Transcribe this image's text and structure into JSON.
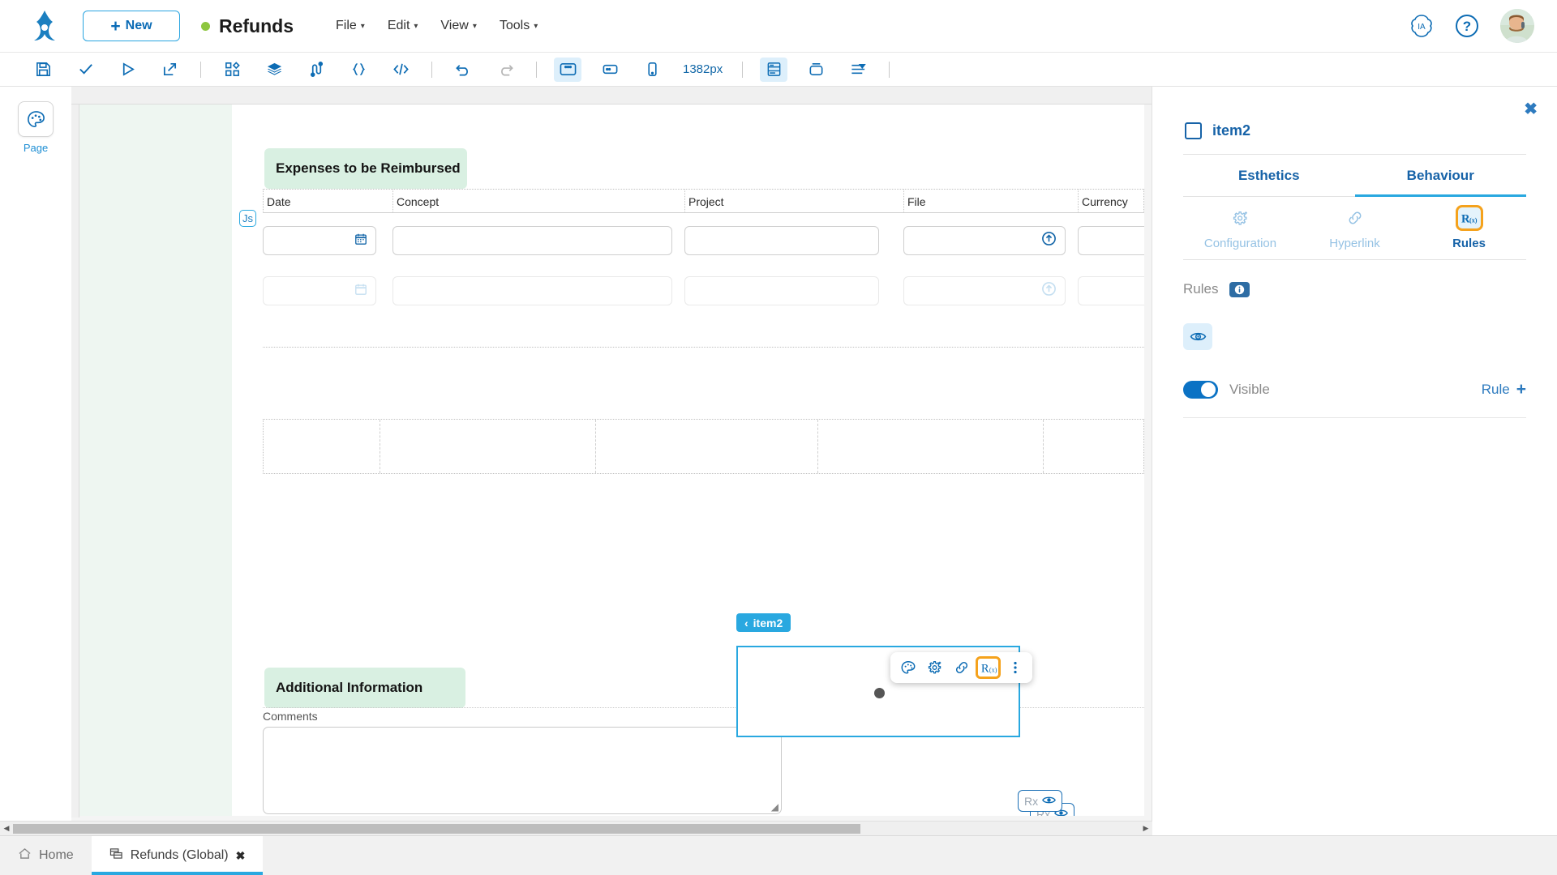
{
  "topbar": {
    "logo_icon": "frog-logo-icon",
    "new_button": {
      "label": "New",
      "plus": "+"
    },
    "status_dot_color": "#8dc63f",
    "document_title": "Refunds",
    "menus": [
      {
        "label": "File",
        "caret": "▾"
      },
      {
        "label": "Edit",
        "caret": "▾"
      },
      {
        "label": "View",
        "caret": "▾"
      },
      {
        "label": "Tools",
        "caret": "▾"
      }
    ],
    "right_icons": [
      {
        "name": "ia-assistant-icon",
        "label": "IA"
      },
      {
        "name": "help-icon",
        "label": "?"
      }
    ],
    "avatar_name": "user-avatar"
  },
  "toolbar": {
    "zoom_width_label": "1382px",
    "buttons": [
      {
        "name": "save-icon"
      },
      {
        "name": "validate-check-icon"
      },
      {
        "name": "run-play-icon"
      },
      {
        "name": "publish-export-icon"
      },
      {
        "name": "components-grid-icon"
      },
      {
        "name": "layers-icon"
      },
      {
        "name": "flow-connectors-icon"
      },
      {
        "name": "braces-data-icon"
      },
      {
        "name": "code-icon"
      },
      {
        "name": "undo-icon"
      },
      {
        "name": "redo-icon"
      },
      {
        "name": "desktop-preview-icon"
      },
      {
        "name": "tablet-preview-icon"
      },
      {
        "name": "mobile-preview-icon"
      },
      {
        "name": "form-layout-icon"
      },
      {
        "name": "container-icon"
      },
      {
        "name": "align-distribute-icon"
      }
    ]
  },
  "left_rail": {
    "items": [
      {
        "name": "page-palette",
        "label": "Page",
        "icon": "palette-icon"
      }
    ]
  },
  "canvas": {
    "sections": [
      {
        "title": "Expenses to be Reimbursed"
      },
      {
        "title": "Additional Information"
      }
    ],
    "expenses_table": {
      "columns": [
        "Date",
        "Concept",
        "Project",
        "File",
        "Currency"
      ],
      "rows": [
        {
          "date": "",
          "concept": "",
          "project": "",
          "file": "",
          "currency": ""
        },
        {
          "date": "",
          "concept": "",
          "project": "",
          "file": "",
          "currency": ""
        }
      ]
    },
    "comments": {
      "label": "Comments",
      "value": ""
    },
    "selected_element": {
      "tag_label": "item2",
      "tag_chevron": "‹"
    },
    "js_badge_label": "Js",
    "rx_badges": [
      {
        "label": "Rx"
      },
      {
        "label": "Rx"
      }
    ],
    "float_toolbar": [
      {
        "name": "esthetics-palette-icon",
        "selected": false
      },
      {
        "name": "configuration-gear-icon",
        "selected": false
      },
      {
        "name": "hyperlink-icon",
        "selected": false
      },
      {
        "name": "rules-rx-icon",
        "selected": true
      },
      {
        "name": "more-options-icon",
        "selected": false
      }
    ]
  },
  "right_panel": {
    "close_label": "✖",
    "element_name": "item2",
    "tabs": [
      {
        "label": "Esthetics",
        "active": false
      },
      {
        "label": "Behaviour",
        "active": true
      }
    ],
    "subtabs": [
      {
        "label": "Configuration",
        "icon": "configuration-gear-icon",
        "active": false
      },
      {
        "label": "Hyperlink",
        "icon": "hyperlink-icon",
        "active": false
      },
      {
        "label": "Rules",
        "icon": "rules-rx-icon",
        "active": true
      }
    ],
    "rules_label": "Rules",
    "rules_info_icon": "info-icon",
    "visibility_icon": "eye-icon",
    "visible_toggle": {
      "label": "Visible",
      "on": true
    },
    "add_rule": {
      "label": "Rule",
      "plus": "+"
    }
  },
  "bottom": {
    "scroll_left_arrow": "◀",
    "scroll_right_arrow": "▶",
    "tabs": [
      {
        "label": "Home",
        "icon": "home-icon",
        "active": false,
        "closable": false
      },
      {
        "label": "Refunds (Global)",
        "icon": "form-icon",
        "active": true,
        "closable": true,
        "close": "✖"
      }
    ]
  },
  "colors": {
    "accent_blue": "#29a8e0",
    "brand_blue": "#1763a8",
    "selection_orange": "#f5a21c",
    "section_green": "#d9f0e2",
    "status_green": "#8dc63f"
  }
}
